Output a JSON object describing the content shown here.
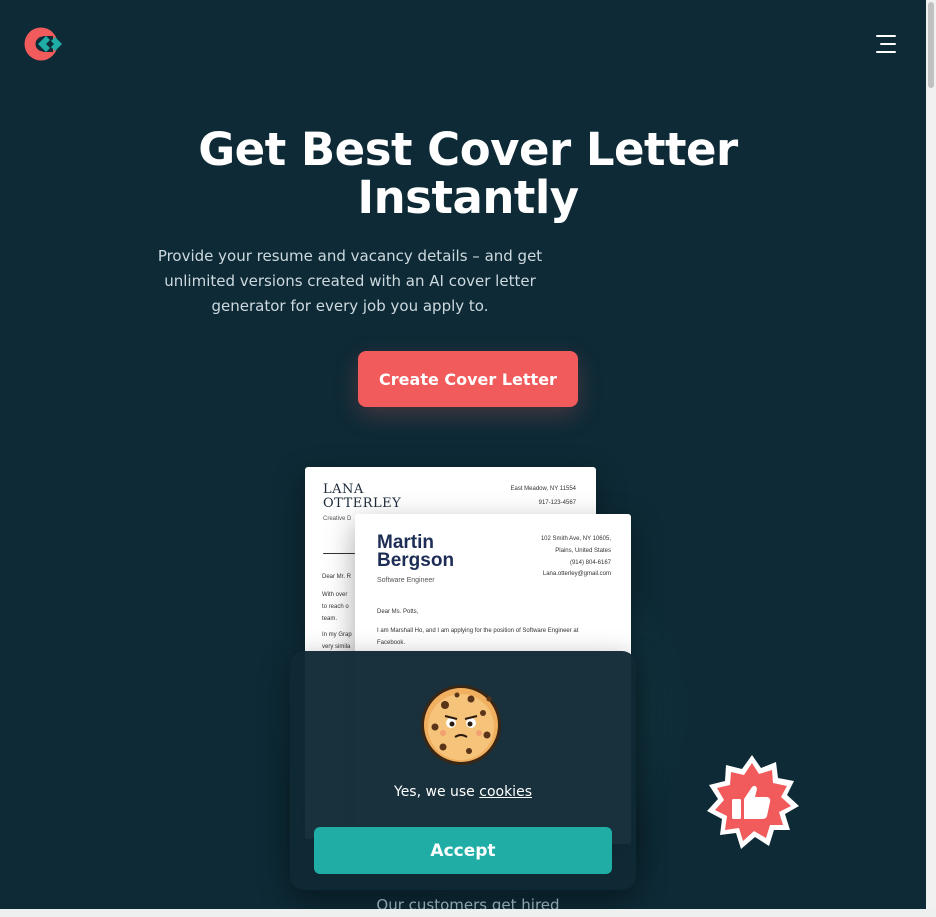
{
  "header": {
    "logo_icon": "coverletter-logo-icon",
    "menu_icon": "hamburger-menu-icon"
  },
  "hero": {
    "title": "Get Best Cover Letter Instantly",
    "subtitle": "Provide your resume and vacancy details – and get unlimited versions created with an AI cover letter generator for every job you apply to.",
    "cta_label": "Create Cover Letter"
  },
  "preview_back": {
    "name_line1": "LANA",
    "name_line2": "OTTERLEY",
    "role": "Creative D",
    "contact_line1": "East Meadow, NY 11554",
    "contact_line2": "917-123-4567",
    "greeting": "Dear Mr. R",
    "body_line1": "With over",
    "body_line2": "to reach o",
    "body_line3": "team.",
    "body_line4": "In my Grap",
    "body_line5": "very simila"
  },
  "preview_front": {
    "name_line1": "Martin",
    "name_line2": "Bergson",
    "role": "Software Engineer",
    "contact_line1": "102 Smith Ave, NY 10605,",
    "contact_line2": "Plains, United States",
    "contact_line3": "(914) 804-6167",
    "contact_line4": "Lana.otterley@gmail.com",
    "greeting": "Dear Ms. Potts,",
    "body_line1": "I am Marshall Ho, and I am applying for the position of Software Engineer at",
    "body_line2": "Facebook."
  },
  "cookie_banner": {
    "image_icon": "cookie-character-icon",
    "text": "Yes, we use",
    "link_text": "cookies",
    "accept_label": "Accept"
  },
  "badge": {
    "icon": "thumbs-up-badge-icon"
  },
  "footer_teaser": {
    "text": "Our customers get hired"
  },
  "colors": {
    "background": "#0d2a36",
    "cta": "#f15b5b",
    "accept": "#1fada6",
    "logo_red": "#f15b5b",
    "logo_teal": "#1fada6"
  }
}
